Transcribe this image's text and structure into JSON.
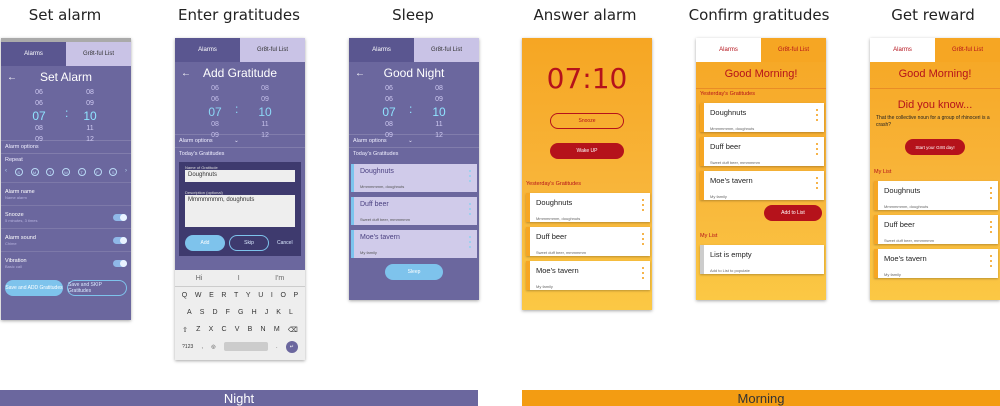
{
  "titles": [
    "Set alarm",
    "Enter gratitudes",
    "Sleep",
    "Answer alarm",
    "Confirm gratitudes",
    "Get reward"
  ],
  "tabs": {
    "alarms": "Alarms",
    "gratitude": "Gr8t-ful List"
  },
  "colors": {
    "night": "#6b679e",
    "morning": "#f6a623",
    "red": "#b5121b"
  },
  "screen1": {
    "header": "Set Alarm",
    "hours": [
      "06",
      "06",
      "07",
      "08",
      "09"
    ],
    "minutes": [
      "08",
      "09",
      "10",
      "11",
      "12"
    ],
    "alarm_options": "Alarm options",
    "repeat": "Repeat",
    "days": [
      "S",
      "M",
      "T",
      "W",
      "T",
      "F",
      "S"
    ],
    "alarm_name": "Alarm name",
    "alarm_name_sub": "Name alarm",
    "snooze": "Snooze",
    "snooze_sub": "5 minutes, 3 times",
    "alarm_sound": "Alarm sound",
    "alarm_sound_sub": "Chime",
    "vibration": "Vibration",
    "vibration_sub": "Basic call",
    "btn_add": "Save and ADD Gratitudes",
    "btn_skip": "Save and SKIP Gratitudes"
  },
  "screen2": {
    "header": "Add Gratitude",
    "alarm_options": "Alarm options",
    "todays": "Today's Gratitudes",
    "name_label": "Name of Gratitude",
    "name_value": "Doughnuts",
    "desc_label": "Description (optional)",
    "desc_value": "Mmmmmmm, doughnuts",
    "btn_add": "Add",
    "btn_skip": "Skip",
    "btn_cancel": "Cancel",
    "suggestions": [
      "Hi",
      "I",
      "I'm"
    ],
    "keys_row1": [
      "Q",
      "W",
      "E",
      "R",
      "T",
      "Y",
      "U",
      "I",
      "O",
      "P"
    ],
    "keys_row2": [
      "A",
      "S",
      "D",
      "F",
      "G",
      "H",
      "J",
      "K",
      "L"
    ],
    "keys_row3": [
      "Z",
      "X",
      "C",
      "V",
      "B",
      "N",
      "M"
    ],
    "key_num": "?123",
    "key_comma": ","
  },
  "screen3": {
    "header": "Good Night",
    "alarm_options": "Alarm options",
    "todays": "Today's Gratitudes",
    "items": [
      {
        "title": "Doughnuts",
        "sub": "Mmmmmmm, doughnuts"
      },
      {
        "title": "Duff beer",
        "sub": "Sweet duff beer, mmmmmm"
      },
      {
        "title": "Moe's tavern",
        "sub": "My family"
      }
    ],
    "btn_sleep": "Sleep"
  },
  "screen4": {
    "time": "07:10",
    "snooze": "Snooze",
    "wake": "Wake UP",
    "yesterday": "Yesterday's Gratitudes",
    "items": [
      {
        "title": "Doughnuts",
        "sub": "Mmmmmmm, doughnuts"
      },
      {
        "title": "Duff beer",
        "sub": "Sweet duff beer, mmmmmm"
      },
      {
        "title": "Moe's tavern",
        "sub": "My family"
      }
    ]
  },
  "screen5": {
    "header": "Good Morning!",
    "yesterday": "Yesterday's Gratitudes",
    "items": [
      {
        "title": "Doughnuts",
        "sub": "Mmmmmmm, doughnuts"
      },
      {
        "title": "Duff beer",
        "sub": "Sweet duff beer, mmmmmm"
      },
      {
        "title": "Moe's tavern",
        "sub": "My family"
      }
    ],
    "add_to_list": "Add to List",
    "my_list": "My List",
    "empty_title": "List is empty",
    "empty_sub": "Add to List to populate"
  },
  "screen6": {
    "header": "Good Morning!",
    "did_you_know": "Did you know...",
    "fact": "That the collective noun for a group of rhinoceri is a crash?",
    "start_day": "Start your Gr8t day!",
    "my_list": "My List",
    "items": [
      {
        "title": "Doughnuts",
        "sub": "Mmmmmmm, doughnuts"
      },
      {
        "title": "Duff beer",
        "sub": "Sweet duff beer, mmmmmm"
      },
      {
        "title": "Moe's tavern",
        "sub": "My family"
      }
    ]
  },
  "bands": {
    "night": "Night",
    "morning": "Morning"
  }
}
